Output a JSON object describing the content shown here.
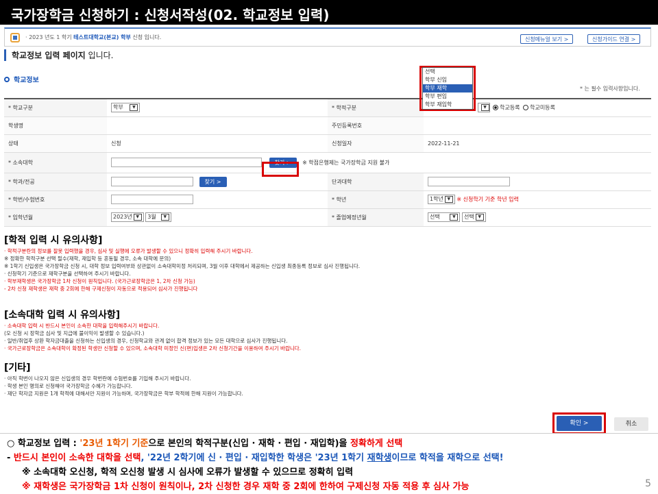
{
  "slide_title": "국가장학금 신청하기 : 신청서작성(02. 학교정보 입력)",
  "topbar": {
    "notice_prefix": "· 2023 년도 1 학기",
    "notice_school": "테스트대학교(본교) 학부",
    "notice_suffix": "신청 입니다.",
    "btn_menu": "신청메뉴얼 보기 >",
    "btn_guide": "신청가이드 연결 >"
  },
  "page_heading_bold": "학교정보 입력 페이지",
  "page_heading_rest": " 입니다.",
  "section_label": "학교정보",
  "required_note": "* 는 필수 입력사항입니다.",
  "form": {
    "school_type_label": "* 학교구분",
    "school_type_value": "학부",
    "enroll_type_label": "* 학적구분",
    "enroll_opt1": "학교등록",
    "enroll_opt2": "학교미등록",
    "student_name_label": "학생명",
    "rrn_label": "주민등록번호",
    "status_label": "상태",
    "status_value": "신청",
    "apply_date_label": "신청일자",
    "apply_date_value": "2022-11-21",
    "univ_label": "* 소속대학",
    "find_btn": "찾기 >",
    "univ_note": "※ 학점은행제는 국가장학금 지원 불가",
    "dept_label": "* 학과/전공",
    "dept_find_btn": "찾기 >",
    "college_label": "단과대학",
    "student_no_label": "* 학번/수험번호",
    "grade_label": "* 학년",
    "grade_value": "1학년",
    "grade_note": "※ 신청학기 기준 학년 입력",
    "entry_label": "* 입학년월",
    "entry_year": "2023년",
    "entry_month": "3월",
    "grad_label": "* 졸업예정년월",
    "grad_sel1": "선택",
    "grad_sel2": "선택"
  },
  "dropdown": {
    "options": [
      "선택",
      "학부 신입",
      "학부 재학",
      "학부 편입",
      "학부 재입학"
    ],
    "highlighted_index": 2
  },
  "notes1": {
    "title": "[학적 입력 시 유의사항]",
    "lines": [
      {
        "t": "· 학적구분란의 정보를 잘못 입력했을 경우, 심사 및 실행에 오류가 발생할 수 있으니 정확히 입력해 주시기 바랍니다.",
        "red": true
      },
      {
        "t": "※ 정확한 학적구분 선택 필수(재학, 재입학 등 혼동될 경우, 소속 대학에 문의)",
        "red": false
      },
      {
        "t": "※ 1학기 신입생은 국가장학금 신청 시, 대학 정보 입력여부와 상관없이 소속대학미정 처리되며, 3월 이후 대학에서 제공하는 신입생 최종등록 정보로 심사 진행됩니다.",
        "red": false
      },
      {
        "t": "· 신청학기 기준으로 재학구분을 선택하여 주시기 바랍니다.",
        "red": false
      },
      {
        "t": "· 학부재학생은 국가장학금 1차 신청이 원칙입니다. (국가근로장학금은 1, 2차 신청 가능)",
        "red": true
      },
      {
        "t": "  - 2차 신청 재학생은 재학 중 2회에 한해 구제신청이 자동으로 적용되어 심사가 진행됩니다",
        "red": true
      }
    ]
  },
  "notes2": {
    "title": "[소속대학 입력 시 유의사항]",
    "lines": [
      {
        "t": "· 소속대학 입력 시 반드시 본인이 소속한 대학을 입력해주시기 바랍니다.",
        "red": true
      },
      {
        "t": "  (오 신청 시 장학금 심사 및 지급에 불이익이 발생할 수 있습니다.)",
        "red": false
      },
      {
        "t": "· 일반/취업후 상환 학자금대출을 신청하는 신입생의 경우, 신청학교와 관계 없이 합격 정보가 있는 모든 대학으로 심사가 진행됩니다.",
        "red": false
      },
      {
        "t": "· 국가근로장학금은 소속대학이 확정된 학생만 신청할 수 있으며, 소속대학 미정인 신(편)입생은 2차 신청기간을 이용하여 주시기 바랍니다.",
        "red": true
      }
    ]
  },
  "notes3": {
    "title": "[기타]",
    "lines": [
      {
        "t": "· 아직 학번이 나오지 않은 신입생의 경우 학번란에 수험번호를 기입해 주시기 바랍니다.",
        "red": false
      },
      {
        "t": "· 학생 본인 명의로 신청해야 국가장학금 수혜가 가능합니다.",
        "red": false
      },
      {
        "t": "· 재단 학자금 지원은 1개 학적에 대해서만 지원이 가능하며, 국가장학금은 학부 학적에 한해 지원이 가능합니다.",
        "red": false
      }
    ]
  },
  "btn_confirm": "확인 >",
  "btn_cancel": "취소",
  "bottom": {
    "l1_a": "○ 학교정보 입력 : ",
    "l1_b": "'23년 1학기 기준",
    "l1_c": "으로 본인의 학적구분(신입 · 재학 · 편입 · 재입학)을 ",
    "l1_d": "정확하게 선택",
    "l2_a": " - ",
    "l2_b": "반드시 본인이 소속한 대학을 선택",
    "l2_c": ", '22년 2학기에 신 · 편입 · 재입학한 학생은 '23년 1학기 ",
    "l2_d": "재학생",
    "l2_e": "이므로 학적을 재학으로 선택!",
    "l3": "※ 소속대학 오신청, 학적 오신청 발생 시 심사에 오류가 발생할 수 있으므로 정확히 입력",
    "l4": "※ 재학생은 국가장학금 1차 신청이 원칙이나, 2차 신청한 경우 재학 중 2회에 한하여 구제신청 자동 적용 후 심사 가능"
  },
  "page_number": "5"
}
